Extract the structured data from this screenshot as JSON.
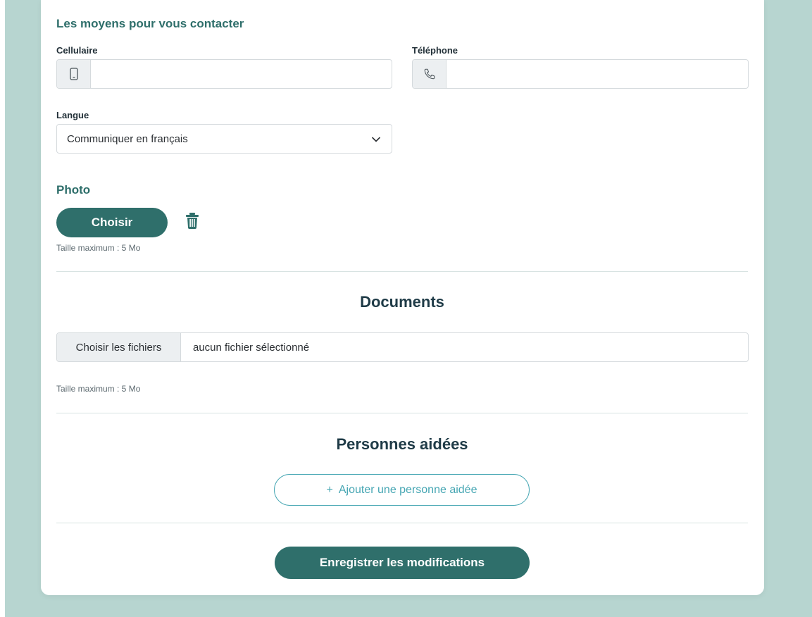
{
  "contact": {
    "section_title": "Les moyens pour vous contacter",
    "cell_label": "Cellulaire",
    "cell_value": "",
    "phone_label": "Téléphone",
    "phone_value": "",
    "language_label": "Langue",
    "language_selected": "Communiquer en français"
  },
  "photo": {
    "title": "Photo",
    "choose_label": "Choisir",
    "max_size": "Taille maximum : 5 Mo"
  },
  "documents": {
    "title": "Documents",
    "choose_files_label": "Choisir les fichiers",
    "status": "aucun fichier sélectionné",
    "max_size": "Taille maximum : 5 Mo"
  },
  "helped": {
    "title": "Personnes aidées",
    "add_icon": "+",
    "add_label": "Ajouter une personne aidée"
  },
  "save_label": "Enregistrer les modifications",
  "colors": {
    "background": "#b7d5d0",
    "primary": "#2f6f6b",
    "accent": "#46a6b3"
  },
  "icons": [
    "mobile-phone-icon",
    "telephone-icon",
    "chevron-down-icon",
    "trash-icon"
  ]
}
